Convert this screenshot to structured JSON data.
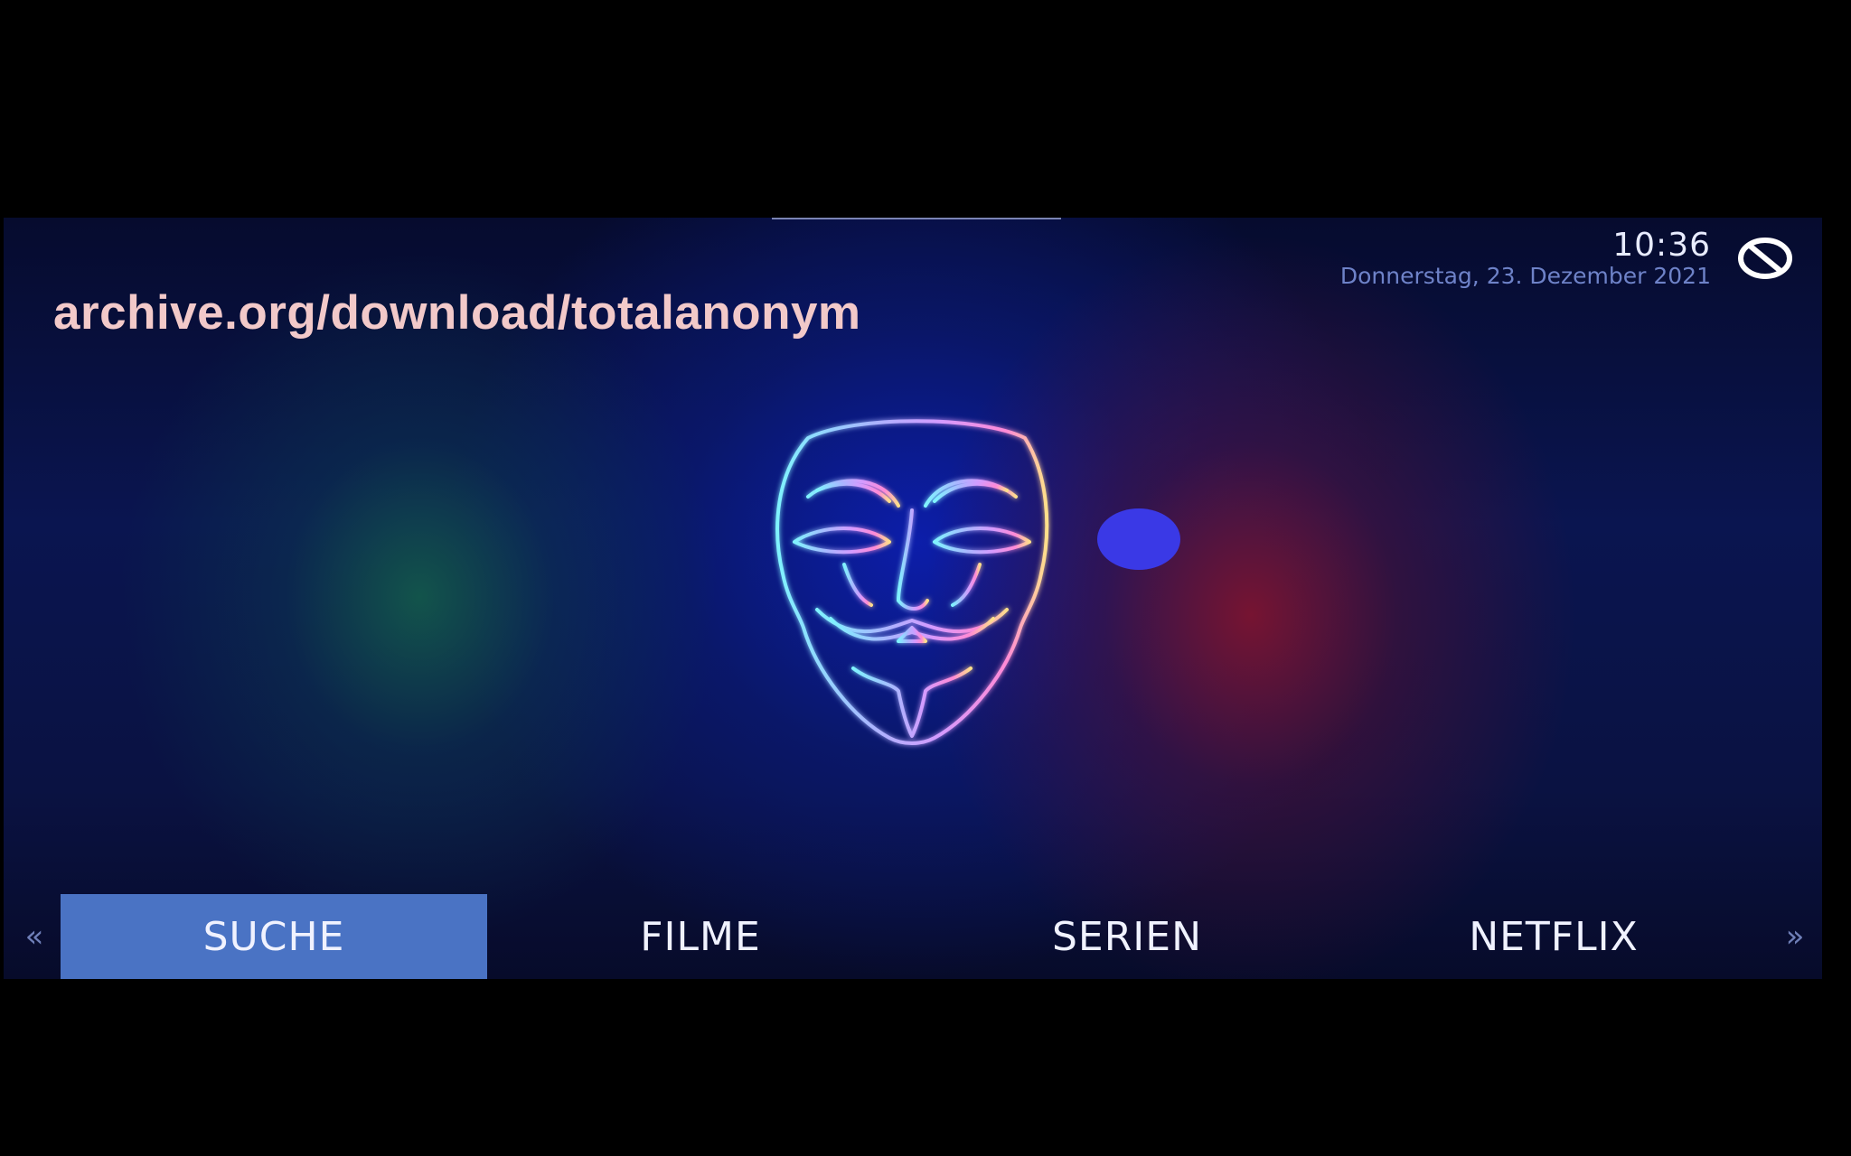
{
  "header": {
    "time": "10:36",
    "date": "Donnerstag, 23. Dezember 2021",
    "status_icon": "no-entry-icon"
  },
  "banner": {
    "url_text": "archive.org/download/totalanonym"
  },
  "center": {
    "logo": "guy-fawkes-mask-icon"
  },
  "menu": {
    "prev_arrow": "«",
    "next_arrow": "»",
    "items": [
      {
        "label": "SUCHE",
        "active": true
      },
      {
        "label": "FILME",
        "active": false
      },
      {
        "label": "SERIEN",
        "active": false
      },
      {
        "label": "NETFLIX",
        "active": false
      }
    ]
  },
  "colors": {
    "accent": "#4a73c4",
    "url_text": "#f2c9c9",
    "date_text": "#6e82c8",
    "dot": "#3a39e6"
  }
}
